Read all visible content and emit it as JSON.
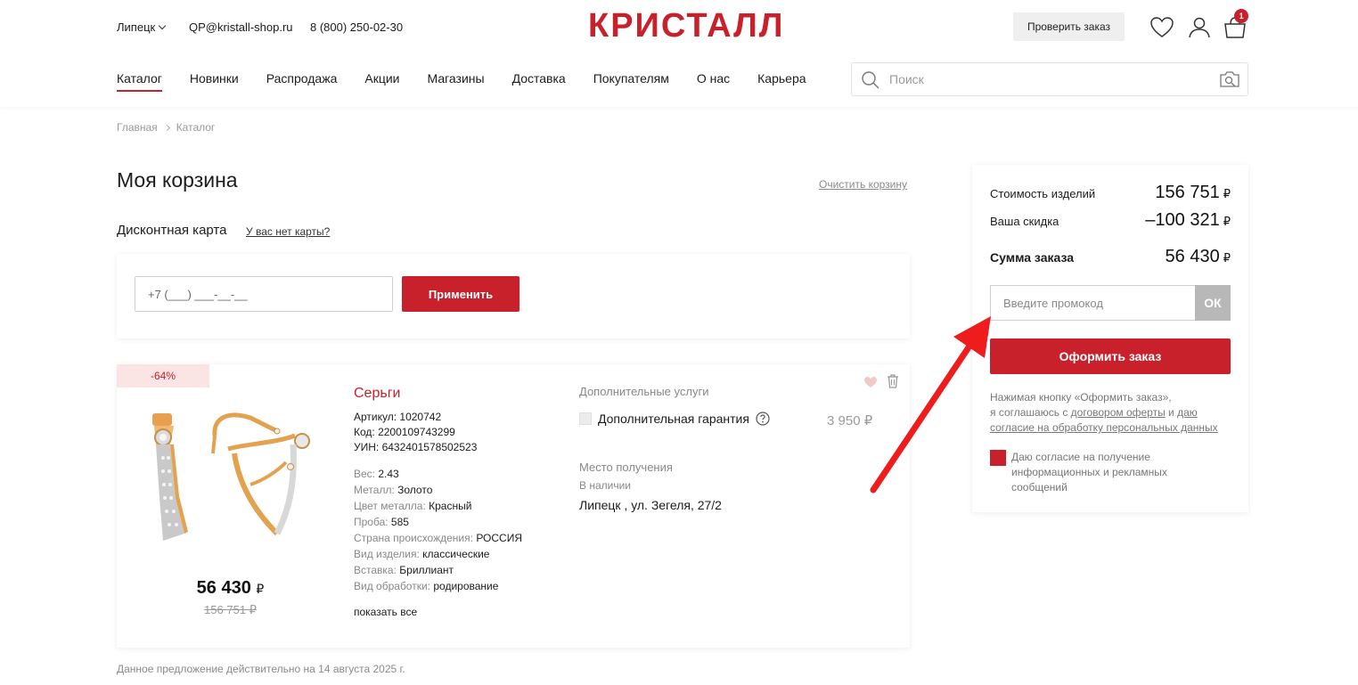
{
  "header": {
    "city": "Липецк",
    "email": "QP@kristall-shop.ru",
    "phone": "8 (800) 250-02-30",
    "logo": "КРИСТАЛЛ",
    "check_order": "Проверить заказ",
    "cart_count": "1",
    "brand_color": "#c8212b"
  },
  "nav": {
    "items": [
      "Каталог",
      "Новинки",
      "Распродажа",
      "Акции",
      "Магазины",
      "Доставка",
      "Покупателям",
      "О нас",
      "Карьера"
    ]
  },
  "search": {
    "placeholder": "Поиск"
  },
  "breadcrumb": {
    "items": [
      "Главная",
      "Каталог"
    ]
  },
  "cart": {
    "title": "Моя корзина",
    "clear": "Очистить корзину",
    "card_label": "Дисконтная карта",
    "no_card": "У вас нет карты?",
    "phone_placeholder": "+7 (___) ___-__-__",
    "apply": "Применить"
  },
  "product": {
    "discount": "-64%",
    "name": "Серьги",
    "article": "Артикул: 1020742",
    "code": "Код: 2200109743299",
    "uin": "УИН: 6432401578502523",
    "specs": [
      {
        "k": "Вес:",
        "v": "2.43"
      },
      {
        "k": "Металл:",
        "v": "Золото"
      },
      {
        "k": "Цвет металла:",
        "v": "Красный"
      },
      {
        "k": "Проба:",
        "v": "585"
      },
      {
        "k": "Страна происхождения:",
        "v": "РОССИЯ"
      },
      {
        "k": "Вид изделия:",
        "v": "классические"
      },
      {
        "k": "Вставка:",
        "v": "Бриллиант"
      },
      {
        "k": "Вид обработки:",
        "v": "родирование"
      }
    ],
    "show_all": "показать все",
    "price": "56 430",
    "currency": "₽",
    "old_price": "156 751 ₽",
    "services_title": "Дополнительные услуги",
    "warranty": "Дополнительная гарантия",
    "warranty_price": "3 950 ₽",
    "pickup_title": "Место получения",
    "pickup_stock": "В наличии",
    "pickup_addr": "Липецк , ул. Зегеля, 27/2"
  },
  "offer_note": "Данное предложение действительно на 14 августа 2025 г.",
  "summary": {
    "items_label": "Стоимость изделий",
    "items_value": "156 751",
    "discount_label": "Ваша скидка",
    "discount_value": "–100 321",
    "total_label": "Сумма заказа",
    "total_value": "56 430",
    "currency": "₽",
    "promo_placeholder": "Введите промокод",
    "promo_ok": "ОК",
    "checkout": "Оформить заказ",
    "terms_1": "Нажимая кнопку «Оформить заказ»,",
    "terms_2": "я соглашаюсь с ",
    "terms_link1": "договором оферты",
    "terms_and": " и ",
    "terms_link2": "даю согласие на обработку персональных данных",
    "consent": "Даю согласие на получение информационных и рекламных сообщений"
  }
}
